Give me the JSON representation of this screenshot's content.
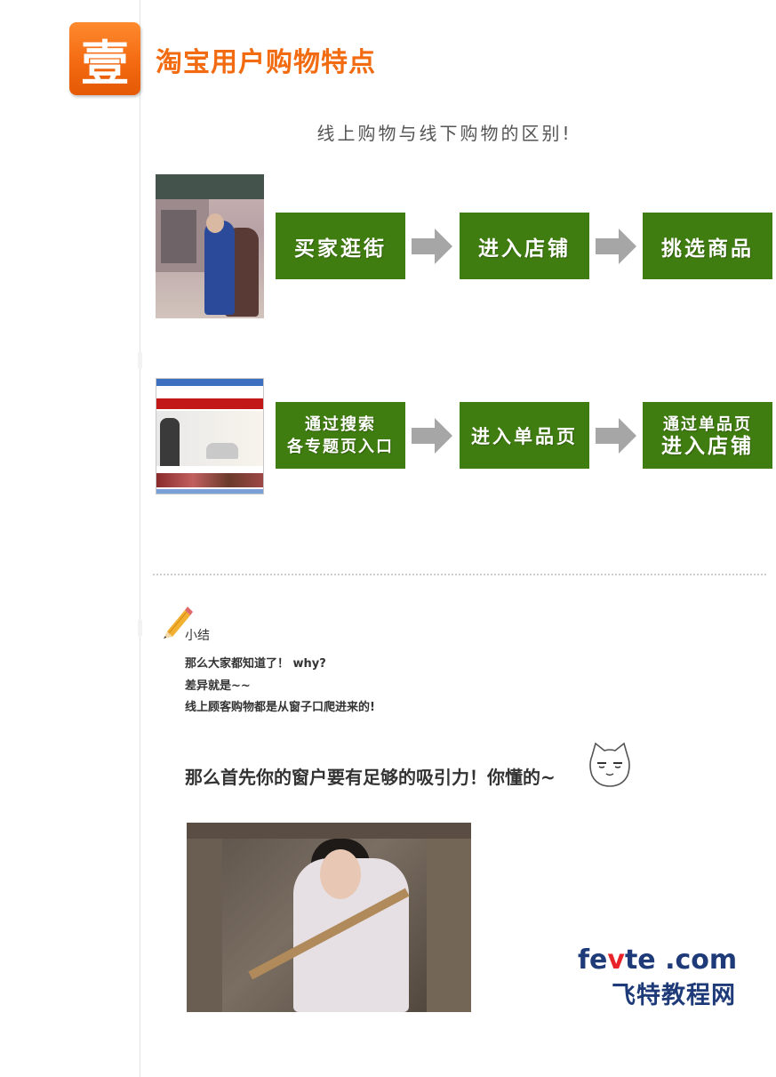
{
  "section": {
    "badge": "壹",
    "title": "淘宝用户购物特点",
    "subtitle": "线上购物与线下购物的区别!"
  },
  "offline_flow": {
    "step1": "买家逛街",
    "step2": "进入店铺",
    "step3": "挑选商品"
  },
  "online_flow": {
    "step1_line1": "通过搜索",
    "step1_line2": "各专题页入口",
    "step2": "进入单品页",
    "step3_line1": "通过单品页",
    "step3_line2": "进入店铺"
  },
  "summary": {
    "label": "小结",
    "line1": "那么大家都知道了！ why?",
    "line2": "差异就是~~",
    "line3": "线上顾客购物都是从窗子口爬进来的!",
    "headline": "那么首先你的窗户要有足够的吸引力！你懂的~"
  },
  "watermark": {
    "logo_prefix": "fe",
    "logo_accent": "v",
    "logo_suffix": "te .com",
    "logo_cn": "飞特教程网"
  },
  "colors": {
    "badge_orange": "#f36a12",
    "title_orange": "#f26b10",
    "step_green": "#407d10",
    "arrow_gray": "#a6a6a6",
    "logo_blue": "#1e3a78",
    "logo_red": "#e8232a"
  }
}
